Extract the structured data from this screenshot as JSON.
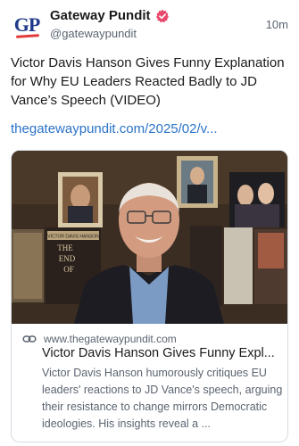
{
  "author": {
    "display_name": "Gateway Pundit",
    "handle": "@gatewaypundit",
    "avatar_text": "GP",
    "verified": true
  },
  "post": {
    "time": "10m",
    "text": "Victor Davis Hanson Gives Funny Explanation for Why EU Leaders Reacted Badly to JD Vance’s Speech (VIDEO)",
    "link_text": "thegatewaypundit.com/2025/02/v..."
  },
  "card": {
    "domain": "www.thegatewaypundit.com",
    "title": "Victor Davis Hanson Gives Funny Expl...",
    "description": "Victor Davis Hanson humorously critiques EU leaders' reactions to JD Vance's speech, arguing their resistance to change mirrors Democratic ideologies. His insights reveal a ...",
    "thumbnail_book_title": "VICTOR DAVIS HANSON",
    "thumbnail_book_words": [
      "THE",
      "END",
      "OF"
    ]
  },
  "colors": {
    "link": "#2a73c9",
    "verified": "#e8486b",
    "brand_blue": "#1f3a8a",
    "brand_red": "#e23b3b"
  },
  "icons": {
    "verified": "verified-badge-icon",
    "link": "link-icon"
  }
}
